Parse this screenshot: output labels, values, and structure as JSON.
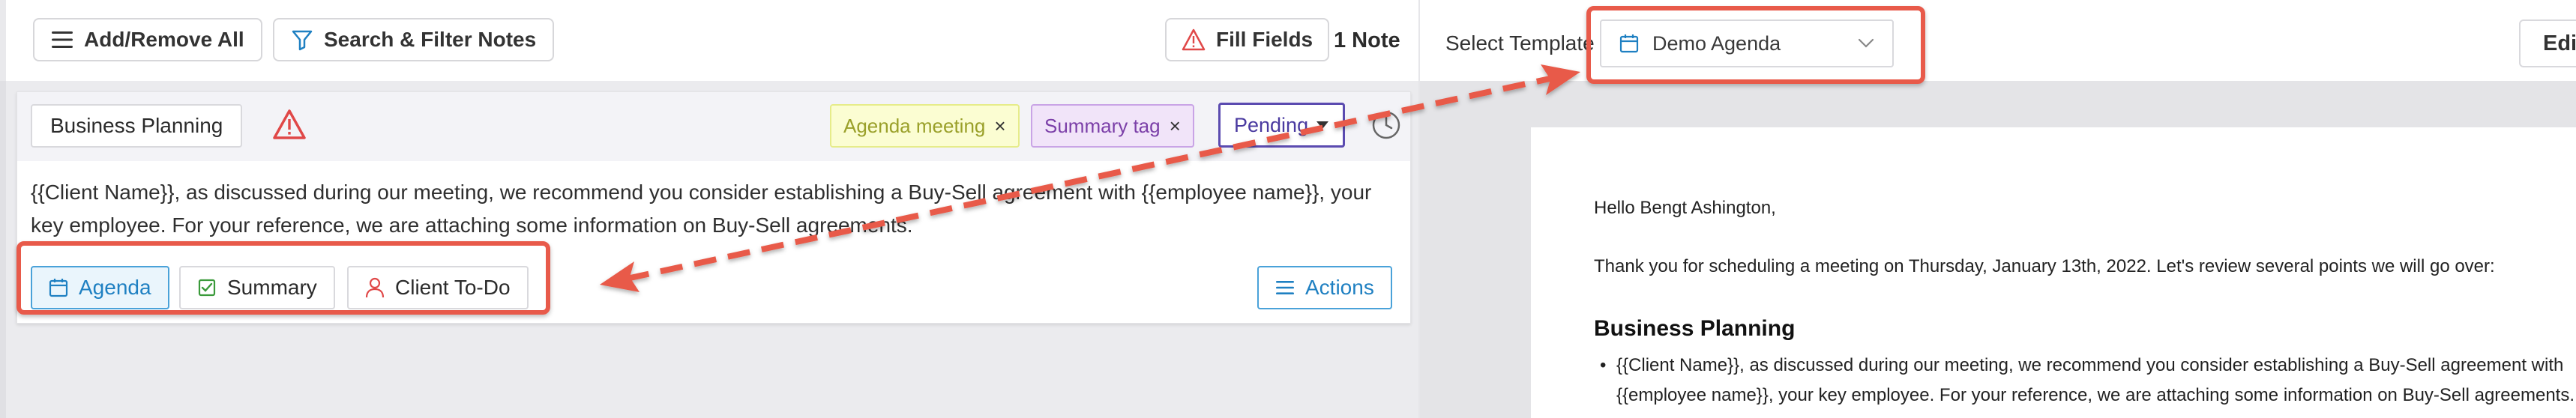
{
  "toolbar": {
    "add_remove_label": "Add/Remove All",
    "search_filter_label": "Search & Filter Notes",
    "fill_fields_label": "Fill Fields",
    "note_count": "1 Note"
  },
  "note": {
    "section_title": "Business Planning",
    "tags": [
      {
        "label": "Agenda meeting",
        "remove": "×"
      },
      {
        "label": "Summary tag",
        "remove": "×"
      }
    ],
    "status": "Pending",
    "text": "{{Client Name}}, as discussed during our meeting, we recommend you consider establishing a Buy-Sell agreement with {{employee name}}, your key employee. For your reference, we are attaching some information on Buy-Sell agreements.",
    "category_buttons": [
      {
        "label": "Agenda",
        "icon": "calendar-icon",
        "active": true
      },
      {
        "label": "Summary",
        "icon": "checkbox-icon",
        "active": false
      },
      {
        "label": "Client To-Do",
        "icon": "user-icon",
        "active": false
      }
    ],
    "actions_label": "Actions"
  },
  "template": {
    "select_label": "Select Template",
    "selected": "Demo Agenda",
    "edit_label": "Edit"
  },
  "document": {
    "greeting": "Hello Bengt Ashington,",
    "thanks": "Thank you for scheduling a meeting on Thursday, January 13th, 2022.  Let's review several points we will go over:",
    "heading": "Business Planning",
    "bullet": "{{Client Name}}, as discussed during our meeting, we recommend you consider establishing a Buy-Sell agreement with {{employee name}}, your key employee. For your reference, we are attaching some information on Buy-Sell agreements."
  },
  "colors": {
    "accent_blue": "#1f80c2",
    "warning_red": "#e04848",
    "annotation_red": "#e85a4a",
    "pending_purple": "#5b4bb0"
  }
}
